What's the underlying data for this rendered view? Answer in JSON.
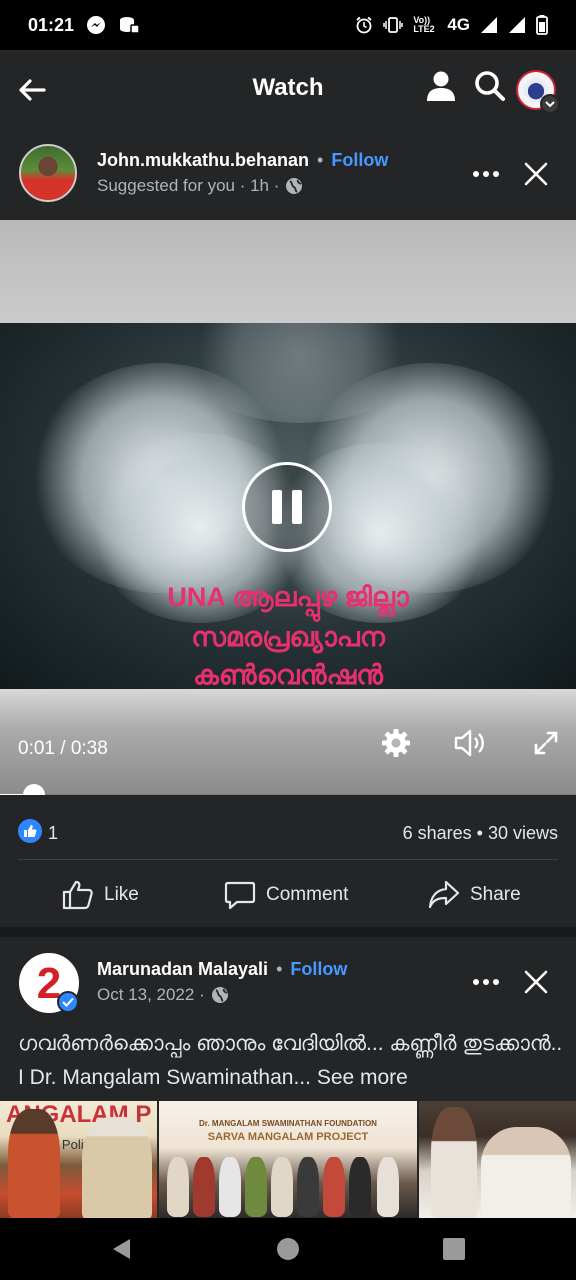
{
  "status_bar": {
    "time": "01:21",
    "network": "4G",
    "volte_label": "Vo)) LTE2",
    "icons": [
      "messenger-icon",
      "data-saver-icon",
      "alarm-icon",
      "vibrate-icon",
      "signal-icon",
      "battery-icon"
    ]
  },
  "header": {
    "title": "Watch",
    "back_icon": "arrow-left-icon",
    "profile_icon": "person-icon",
    "search_icon": "search-icon"
  },
  "post1": {
    "author": "John.mukkathu.behanan",
    "separator": "•",
    "follow_label": "Follow",
    "meta": "Suggested for you · 1h ·",
    "video": {
      "caption_lines": [
        "UNA ആലപ്പുഴ ജില്ലാ",
        "സമരപ്രഖ്യാപന",
        "കൺവെൻഷൻ"
      ],
      "time": "0:01 / 0:38",
      "progress": 0.026
    },
    "likes_count": "1",
    "shares_views": "6 shares • 30 views",
    "actions": {
      "like": "Like",
      "comment": "Comment",
      "share": "Share"
    }
  },
  "post2": {
    "author": "Marunadan Malayali",
    "separator": "•",
    "follow_label": "Follow",
    "meta": "Oct 13, 2022 ·",
    "text": "ഗവർണർക്കൊപ്പം ഞാനും വേദിയിൽ... കണ്ണീർ തുടക്കാൻ.. I Dr. Mangalam Swaminathan...",
    "see_more": "See more",
    "image1_banner": "ANGALAM P",
    "image1_sub": "Victi    Polit",
    "image2_org": "Dr. MANGALAM SWAMINATHAN FOUNDATION",
    "image2_project": "SARVA MANGALAM PROJECT"
  },
  "colors": {
    "background": "#18191a",
    "surface": "#242526",
    "accent": "#4599ff",
    "like_blue": "#2d88ff",
    "caption_pink": "#e8306f"
  }
}
